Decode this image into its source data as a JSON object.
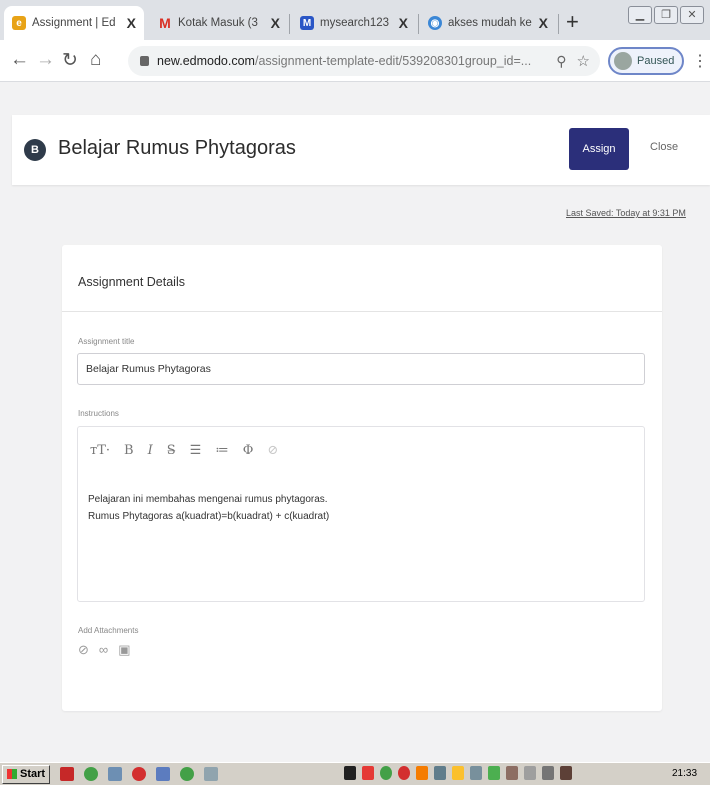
{
  "browser": {
    "tabs": [
      {
        "label": "Assignment | Ed",
        "close": "X",
        "favicon": "edmodo-e-icon",
        "color": "#e8a317",
        "active": true
      },
      {
        "label": "Kotak Masuk (3",
        "close": "X",
        "favicon": "gmail-icon",
        "color": "#d93025",
        "active": false
      },
      {
        "label": "mysearch123",
        "close": "X",
        "favicon": "mail-icon",
        "color": "#2a56c6",
        "active": false
      },
      {
        "label": "akses mudah ke",
        "close": "X",
        "favicon": "globe-icon",
        "color": "#3b87d6",
        "active": false
      }
    ],
    "new_tab": "+",
    "url_host": "new.edmodo.com",
    "url_path": "/assignment-template-edit/539208301group_id=...",
    "profile_status": "Paused"
  },
  "header": {
    "badge": "B",
    "title": "Belajar Rumus Phytagoras",
    "assign_label": "Assign",
    "close_label": "Close"
  },
  "last_saved": "Last Saved: Today at 9:31 PM",
  "card": {
    "title": "Assignment Details",
    "title_field_label": "Assignment title",
    "title_value": "Belajar Rumus Phytagoras",
    "instructions_label": "Instructions",
    "instructions_line1": "Pelajaran ini membahas mengenai rumus phytagoras.",
    "instructions_line2": "Rumus Phytagoras a(kuadrat)=b(kuadrat) + c(kuadrat)",
    "attachments_label": "Add Attachments"
  },
  "taskbar": {
    "start": "Start",
    "clock": "21:33"
  },
  "colors": {
    "primary_button": "#2b2f7a",
    "background": "#f2f2f3"
  }
}
